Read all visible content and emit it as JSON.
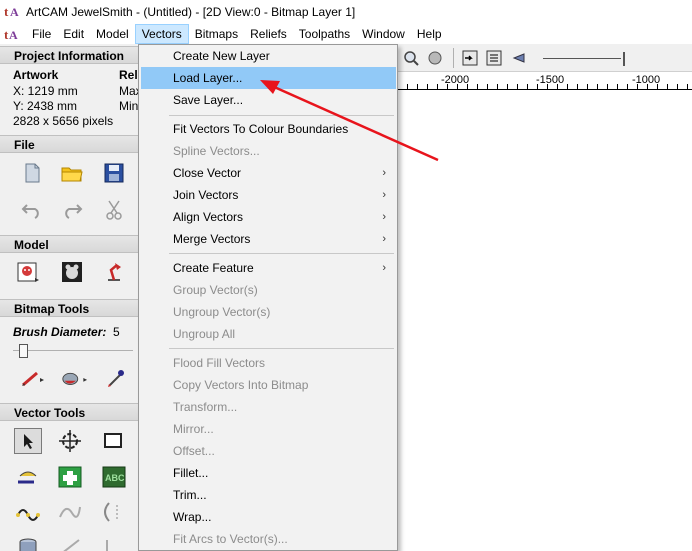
{
  "window": {
    "title": "ArtCAM JewelSmith - (Untitled) - [2D View:0 - Bitmap Layer 1]"
  },
  "menubar": {
    "items": [
      "File",
      "Edit",
      "Model",
      "Vectors",
      "Bitmaps",
      "Reliefs",
      "Toolpaths",
      "Window",
      "Help"
    ],
    "active": "Vectors"
  },
  "project": {
    "header": "Project Information",
    "artwork_label": "Artwork",
    "x": "X: 1219 mm",
    "y": "Y: 2438 mm",
    "pixels": "2828 x 5656 pixels",
    "col2_label": "Rel",
    "col2_row1": "Max",
    "col2_row2": "Min"
  },
  "file_section": {
    "header": "File"
  },
  "model_section": {
    "header": "Model"
  },
  "bitmap_section": {
    "header": "Bitmap Tools",
    "brush_label": "Brush Diameter:",
    "brush_value": "5"
  },
  "vector_section": {
    "header": "Vector Tools"
  },
  "ruler": {
    "labels": [
      "-2000",
      "-1500",
      "-1000"
    ]
  },
  "vectors_menu": {
    "items": [
      {
        "label": "Create New Layer",
        "enabled": true,
        "submenu": false
      },
      {
        "label": "Load Layer...",
        "enabled": true,
        "submenu": false,
        "highlighted": true
      },
      {
        "label": "Save Layer...",
        "enabled": true,
        "submenu": false
      },
      {
        "label": "Fit Vectors To Colour Boundaries",
        "enabled": true,
        "submenu": false
      },
      {
        "label": "Spline Vectors...",
        "enabled": false,
        "submenu": false
      },
      {
        "label": "Close Vector",
        "enabled": true,
        "submenu": true
      },
      {
        "label": "Join Vectors",
        "enabled": true,
        "submenu": true
      },
      {
        "label": "Align Vectors",
        "enabled": true,
        "submenu": true
      },
      {
        "label": "Merge Vectors",
        "enabled": true,
        "submenu": true
      },
      {
        "label": "Create Feature",
        "enabled": true,
        "submenu": true
      },
      {
        "label": "Group Vector(s)",
        "enabled": false,
        "submenu": false
      },
      {
        "label": "Ungroup Vector(s)",
        "enabled": false,
        "submenu": false
      },
      {
        "label": "Ungroup All",
        "enabled": false,
        "submenu": false
      },
      {
        "label": "Flood Fill Vectors",
        "enabled": false,
        "submenu": false
      },
      {
        "label": "Copy Vectors Into Bitmap",
        "enabled": false,
        "submenu": false
      },
      {
        "label": "Transform...",
        "enabled": false,
        "submenu": false
      },
      {
        "label": "Mirror...",
        "enabled": false,
        "submenu": false
      },
      {
        "label": "Offset...",
        "enabled": false,
        "submenu": false
      },
      {
        "label": "Fillet...",
        "enabled": true,
        "submenu": false
      },
      {
        "label": "Trim...",
        "enabled": true,
        "submenu": false
      },
      {
        "label": "Wrap...",
        "enabled": true,
        "submenu": false
      },
      {
        "label": "Fit Arcs to Vector(s)...",
        "enabled": false,
        "submenu": false
      }
    ],
    "submenu_arrow": "›"
  },
  "colors": {
    "highlight": "#91c9f7",
    "annotation_arrow": "#e8141c",
    "disabled_text": "#8c8c8c"
  }
}
